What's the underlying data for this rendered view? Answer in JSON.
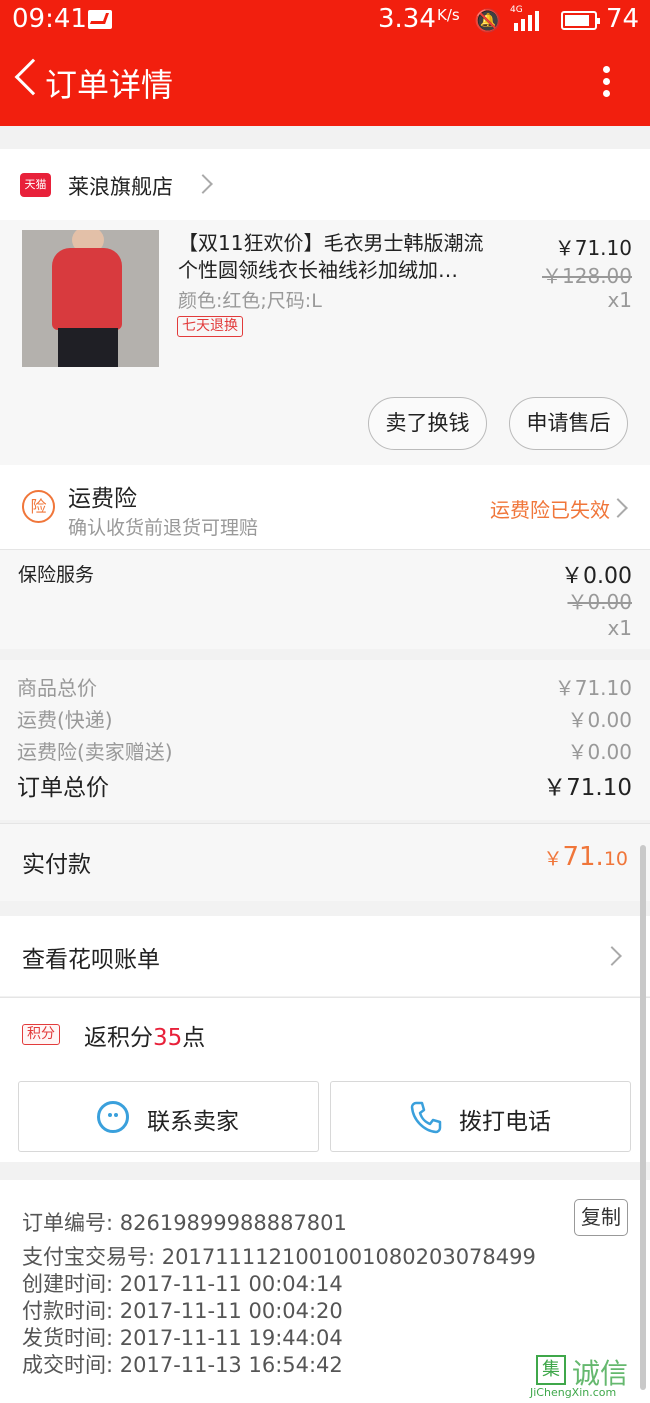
{
  "status_bar": {
    "time": "09:41",
    "speed": "3.34",
    "speed_unit": "K/s",
    "network": "4G",
    "battery": "74"
  },
  "header": {
    "title": "订单详情"
  },
  "shop": {
    "badge": "天猫",
    "name": "莱浪旗舰店"
  },
  "product": {
    "title_line1": "【双11狂欢价】毛衣男士韩版潮流",
    "title_line2": "个性圆领线衣长袖线衫加绒加…",
    "attributes": "颜色:红色;尺码:L",
    "return_badge": "七天退换",
    "price": "￥71.10",
    "original_price": "￥128.00",
    "quantity": "x1",
    "sell_button": "卖了换钱",
    "aftersale_button": "申请售后"
  },
  "shipping_insurance": {
    "icon_text": "险",
    "title": "运费险",
    "subtitle": "确认收货前退货可理赔",
    "status": "运费险已失效"
  },
  "insurance_service": {
    "label": "保险服务",
    "price": "￥0.00",
    "original_price": "￥0.00",
    "quantity": "x1"
  },
  "summary": {
    "rows": [
      {
        "label": "商品总价",
        "value": "￥71.10"
      },
      {
        "label": "运费(快递)",
        "value": "￥0.00"
      },
      {
        "label": "运费险(卖家赠送)",
        "value": "￥0.00"
      }
    ],
    "total_label": "订单总价",
    "total_value": "￥71.10"
  },
  "payment": {
    "label": "实付款",
    "currency": "￥",
    "amount_int": "71.",
    "amount_dec": "10"
  },
  "huabei": {
    "label": "查看花呗账单"
  },
  "points": {
    "badge": "积分",
    "prefix": "返积分",
    "count": "35",
    "suffix": "点"
  },
  "contact": {
    "seller_label": "联系卖家",
    "phone_label": "拨打电话"
  },
  "order_info": {
    "order_no": "订单编号: 82619899988887801",
    "copy_label": "复制",
    "alipay_no": "支付宝交易号: 2017111121001001080203078499",
    "created": "创建时间: 2017-11-11  00:04:14",
    "paid": "付款时间: 2017-11-11  00:04:20",
    "shipped": "发货时间: 2017-11-11  19:44:04",
    "completed": "成交时间: 2017-11-13  16:54:42"
  },
  "watermark": {
    "box": "集",
    "text": "诚信",
    "site": "JiChengXin.com"
  }
}
